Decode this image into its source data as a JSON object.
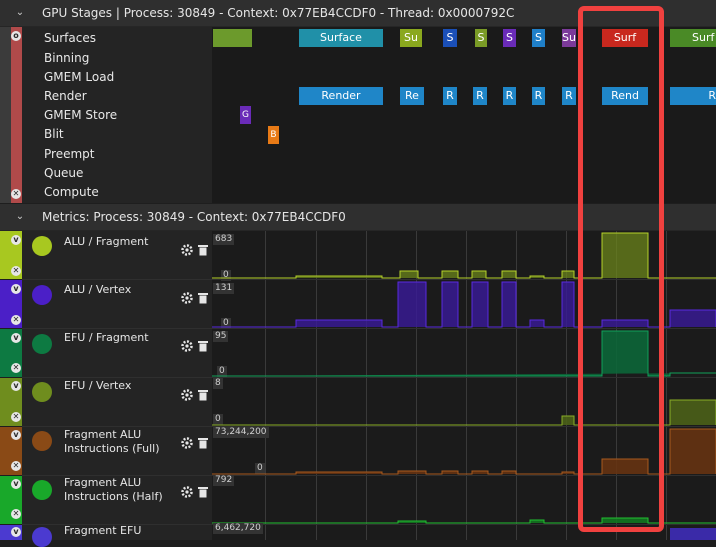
{
  "gpu_stages": {
    "title": "GPU Stages | Process: 30849 - Context: 0x77EB4CCDF0 - Thread: 0x0000792C",
    "rows": [
      "Surfaces",
      "Binning",
      "GMEM Load",
      "Render",
      "GMEM Store",
      "Blit",
      "Preempt",
      "Queue",
      "Compute"
    ],
    "surface_blocks": [
      "Surface",
      "Su",
      "S",
      "S",
      "S",
      "S",
      "Su",
      "Surf",
      "Surf"
    ],
    "render_blocks": [
      "Render",
      "Re",
      "R",
      "R",
      "R",
      "R",
      "R",
      "Rend",
      "R"
    ],
    "gmem_store_block": "G",
    "blit_block": "B"
  },
  "metrics": {
    "title": "Metrics: Process: 30849 - Context: 0x77EB4CCDF0",
    "rows": [
      {
        "name": "ALU / Fragment",
        "max": "683",
        "min": "0",
        "color": "#a8c820"
      },
      {
        "name": "ALU / Vertex",
        "max": "131",
        "min": "0",
        "color": "#4b1fc7"
      },
      {
        "name": "EFU / Fragment",
        "max": "95",
        "min": "0",
        "color": "#0d7a42"
      },
      {
        "name": "EFU / Vertex",
        "max": "8",
        "min": "0",
        "color": "#6f8d1e"
      },
      {
        "name": "Fragment ALU Instructions (Full)",
        "max": "73,244,200",
        "min": "0",
        "color": "#8a4a16"
      },
      {
        "name": "Fragment ALU Instructions (Half)",
        "max": "792",
        "min": "0",
        "color": "#19a82a"
      },
      {
        "name": "Fragment EFU",
        "max": "6,462,720",
        "min": "",
        "color": "#4b3ad0"
      }
    ]
  },
  "icons": {
    "collapse": "chevron-down-icon",
    "settings": "gear-icon",
    "delete": "trash-icon",
    "close": "close-icon"
  }
}
